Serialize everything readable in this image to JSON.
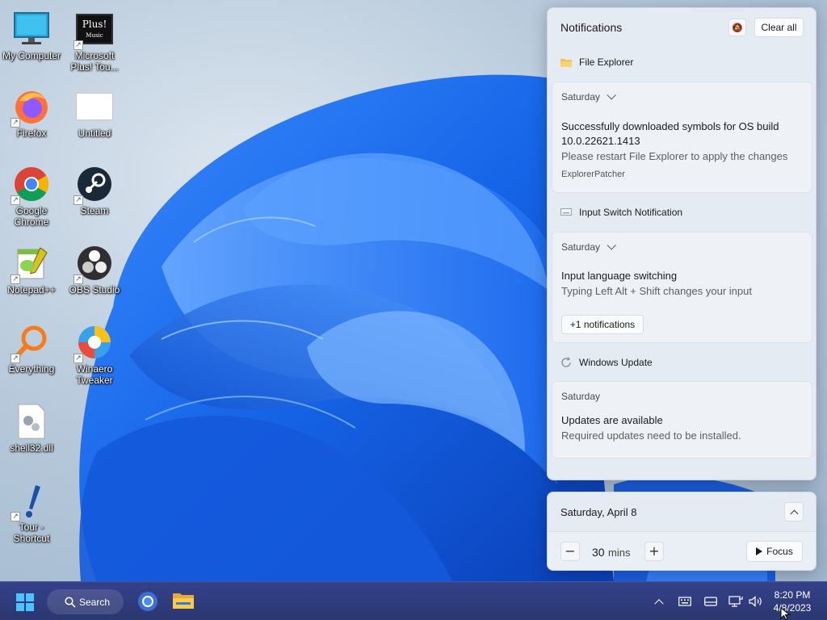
{
  "desktop": {
    "icons": [
      {
        "label": "My Computer",
        "icon": "computer-icon"
      },
      {
        "label": "Microsoft Plus! Tou...",
        "icon": "plus-music-icon"
      },
      {
        "label": "Firefox",
        "icon": "firefox-icon"
      },
      {
        "label": "Untitled",
        "icon": "blank-document-icon"
      },
      {
        "label": "Google Chrome",
        "icon": "chrome-icon"
      },
      {
        "label": "Steam",
        "icon": "steam-icon"
      },
      {
        "label": "Notepad++",
        "icon": "notepadpp-icon"
      },
      {
        "label": "OBS Studio",
        "icon": "obs-icon"
      },
      {
        "label": "Everything",
        "icon": "everything-search-icon"
      },
      {
        "label": "Winaero Tweaker",
        "icon": "winaero-icon"
      },
      {
        "label": "shell32.dll",
        "icon": "dll-file-icon"
      },
      {
        "label": "Tour - Shortcut",
        "icon": "tour-icon"
      }
    ],
    "plus_icon_text": "Plus!",
    "plus_icon_subtext": "Music"
  },
  "notifications": {
    "title": "Notifications",
    "clear_all": "Clear all",
    "groups": [
      {
        "app": "File Explorer",
        "icon": "folder-icon",
        "day": "Saturday",
        "title": "Successfully downloaded symbols for OS build 10.0.22621.1413",
        "body": "Please restart File Explorer to apply the changes",
        "source": "ExplorerPatcher"
      },
      {
        "app": "Input Switch Notification",
        "icon": "keyboard-icon",
        "day": "Saturday",
        "title": "Input language switching",
        "body": "Typing Left Alt + Shift changes your input",
        "more": "+1 notifications"
      },
      {
        "app": "Windows Update",
        "icon": "update-icon",
        "day": "Saturday",
        "title": "Updates are available",
        "body": "Required updates need to be installed."
      }
    ]
  },
  "calendar": {
    "date": "Saturday, April 8",
    "focus_minutes": "30",
    "focus_unit": "mins",
    "focus_label": "Focus",
    "minus": "−",
    "plus": "+"
  },
  "taskbar": {
    "search_label": "Search",
    "time": "8:20 PM",
    "date": "4/8/2023",
    "accent": "#4cc2ff"
  }
}
